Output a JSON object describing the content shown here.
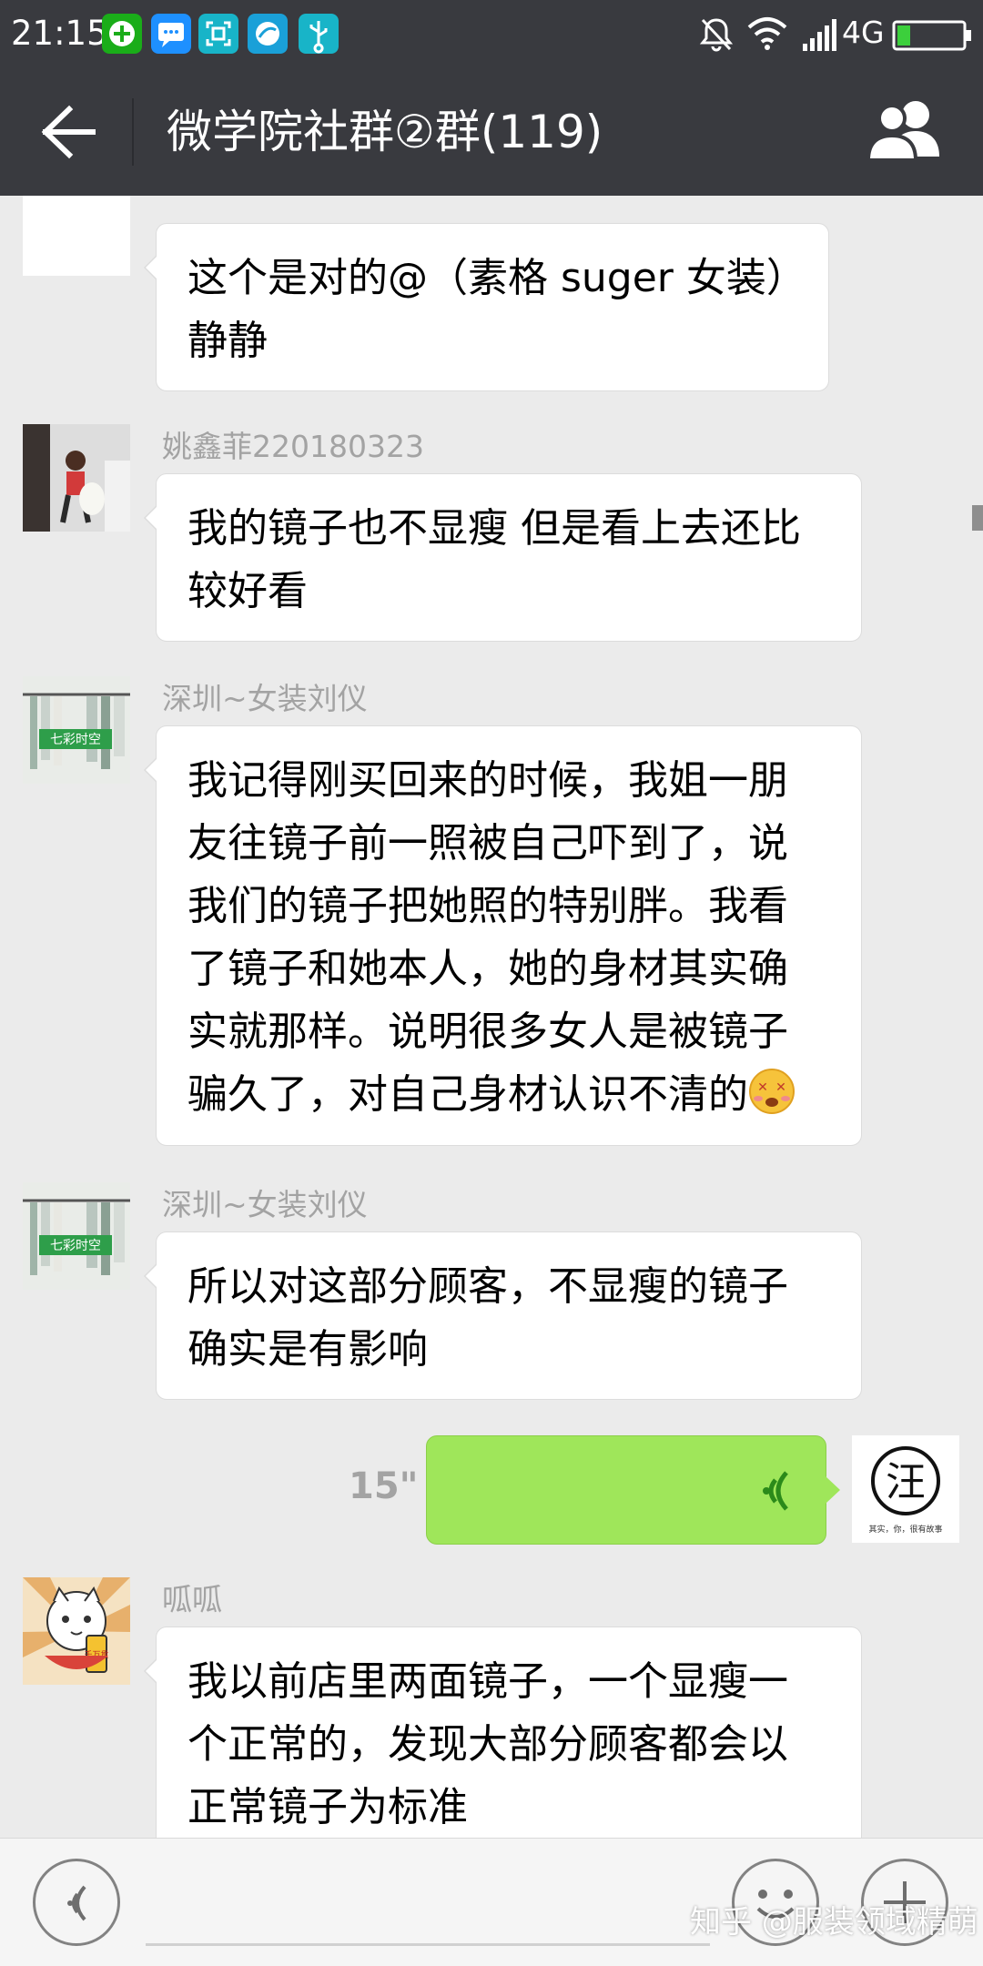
{
  "status_bar": {
    "time": "21:15",
    "network": "4G",
    "icons": [
      "wechat-app-icon",
      "message-app-icon",
      "scan-app-icon",
      "browser-app-icon",
      "usb-icon",
      "mute-icon",
      "wifi-icon",
      "signal-icon",
      "battery-icon"
    ],
    "battery_level": 0.2
  },
  "header": {
    "title": "微学院社群②群(119)",
    "back_icon": "arrow-left-icon",
    "members_icon": "group-members-icon"
  },
  "messages": [
    {
      "sender": "",
      "lines": [
        "这个是对的@（素格 suger 女装）",
        "静静"
      ]
    },
    {
      "sender": "姚鑫菲220180323",
      "lines": [
        "我的镜子也不显瘦 但是看上去还比",
        "较好看"
      ]
    },
    {
      "sender": "深圳~女装刘仪",
      "lines": [
        "我记得刚买回来的时候，我姐一朋",
        "友往镜子前一照被自己吓到了，说",
        "我们的镜子把她照的特别胖。我看",
        "了镜子和她本人，她的身材其实确",
        "实就那样。说明很多女人是被镜子",
        "骗久了，对自己身材认识不清的"
      ],
      "emoji": "dizzy-face-emoji"
    },
    {
      "sender": "深圳~女装刘仪",
      "lines": [
        "所以对这部分顾客，不显瘦的镜子",
        "确实是有影响"
      ]
    },
    {
      "voice_duration": "15\"",
      "self_avatar_char": "汪",
      "self_avatar_caption": "其实，你，很有故事"
    },
    {
      "sender": "呱呱",
      "avatar_caption": "千万贯",
      "lines": [
        "我以前店里两面镜子，一个显瘦一",
        "个正常的，发现大部分顾客都会以",
        "正常镜子为标准"
      ]
    }
  ],
  "tag_text": "七彩时空",
  "input_bar": {
    "voice_icon": "voice-input-icon",
    "emoji_icon": "emoji-icon",
    "plus_icon": "plus-icon"
  },
  "watermark": "知乎 @服装领域精萌",
  "colors": {
    "header_bg": "#393a3f",
    "chat_bg": "#ebebeb",
    "voice_bubble": "#9fe65a",
    "sender_text": "#a3a3a3"
  }
}
